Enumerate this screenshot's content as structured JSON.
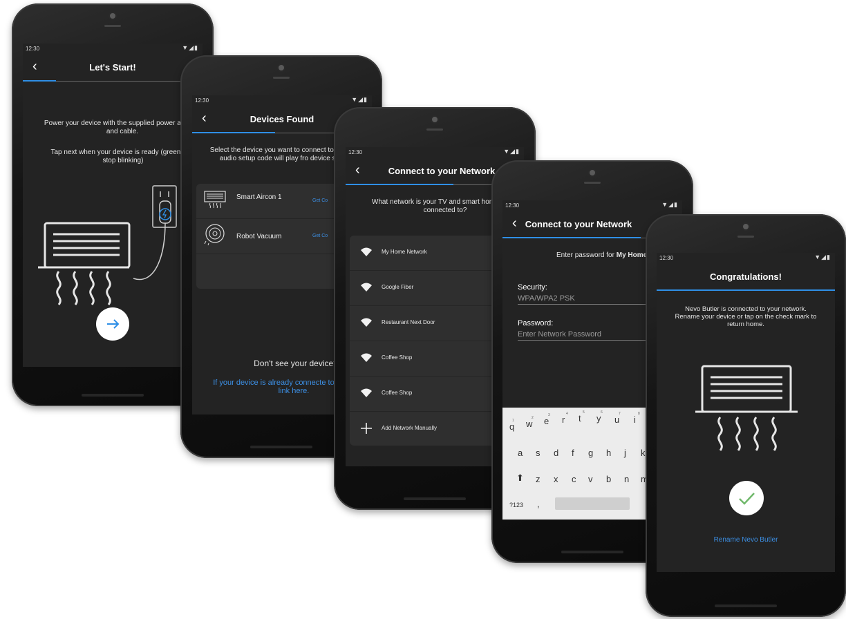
{
  "status": {
    "time": "12:30",
    "signal": "▼◢▮"
  },
  "screens": {
    "start": {
      "title": "Let's Start!",
      "instruction_1": "Power your device with the supplied power adapter and cable.",
      "instruction_2": "Tap next when your device is ready (green light stop blinking)"
    },
    "devices": {
      "title": "Devices Found",
      "instruction": "Select the device you want to connect to network. A audio setup code will play fro device speaker.",
      "items": [
        {
          "name": "Smart Aircon 1",
          "action": "Get Co"
        },
        {
          "name": "Robot Vacuum",
          "action": "Get Co"
        }
      ],
      "help_title": "Don't see your device?",
      "help_link": "If your device is already connecte to the internet link here."
    },
    "network": {
      "title": "Connect to your Network",
      "instruction": "What network is your TV and smart hon devices connected to?",
      "networks": [
        "My Home Network",
        "Google Fiber",
        "Restaurant Next Door",
        "Coffee Shop",
        "Coffee Shop"
      ],
      "add_manual": "Add Network Manually"
    },
    "password": {
      "title": "Connect to your Network",
      "instruction_prefix": "Enter password for ",
      "instruction_network": "My Home Netwo",
      "security_label": "Security:",
      "security_value": "WPA/WPA2 PSK",
      "password_label": "Password:",
      "password_placeholder": "Enter Network Password",
      "keyboard": {
        "row1": [
          "q",
          "w",
          "e",
          "r",
          "t",
          "y",
          "u",
          "i"
        ],
        "row1_sup": [
          "1",
          "2",
          "3",
          "4",
          "5",
          "6",
          "7",
          "8"
        ],
        "row2": [
          "a",
          "s",
          "d",
          "f",
          "g",
          "h",
          "j",
          "k"
        ],
        "row3": [
          "z",
          "x",
          "c",
          "v",
          "b",
          "n",
          "m"
        ],
        "sym": "?123",
        "comma": ","
      }
    },
    "done": {
      "title": "Congratulations!",
      "message": "Nevo Butler is connected to your network. Rename your device or tap on the check mark to return home.",
      "rename": "Rename Nevo Butler"
    }
  },
  "colors": {
    "accent": "#2f8fe6",
    "screen_bg": "#232323",
    "check": "#6fb86a"
  }
}
